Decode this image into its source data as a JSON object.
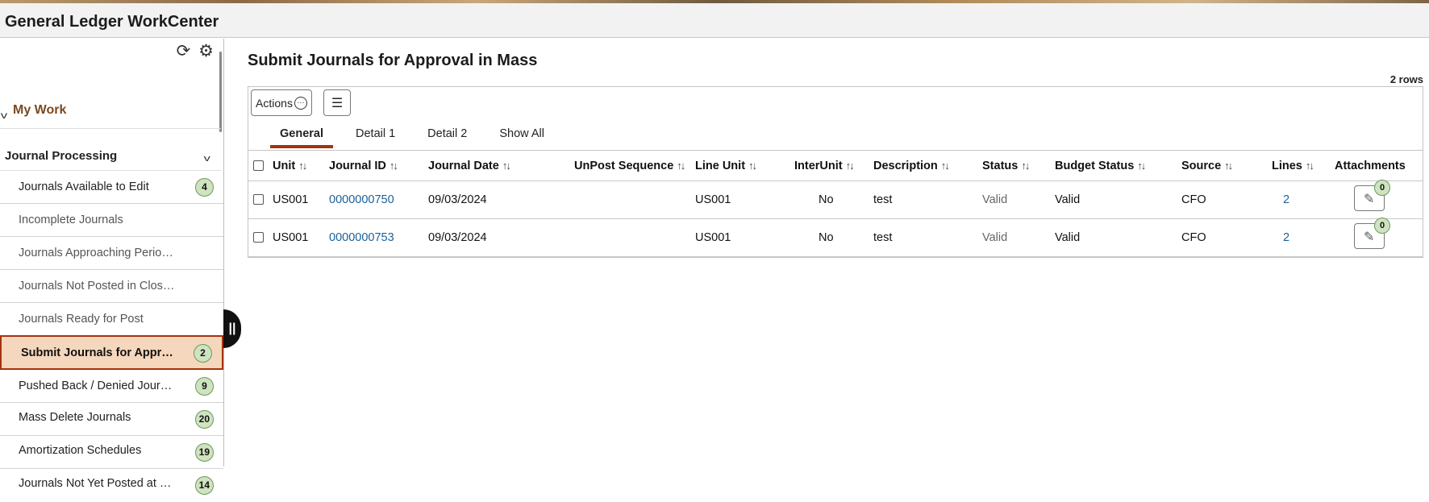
{
  "app": {
    "title": "General Ledger WorkCenter"
  },
  "sidebar": {
    "my_work_label": "My Work",
    "section_label": "Journal Processing",
    "items": [
      {
        "label": "Journals Available to Edit",
        "badge": "4",
        "muted": false
      },
      {
        "label": "Incomplete Journals",
        "badge": "",
        "muted": true
      },
      {
        "label": "Journals Approaching Perio…",
        "badge": "",
        "muted": true
      },
      {
        "label": "Journals Not Posted in Clos…",
        "badge": "",
        "muted": true
      },
      {
        "label": "Journals Ready for Post",
        "badge": "",
        "muted": true
      },
      {
        "label": "Submit Journals for Appr…",
        "badge": "2",
        "muted": false,
        "active": true
      },
      {
        "label": "Pushed Back / Denied Jour…",
        "badge": "9",
        "muted": false
      },
      {
        "label": "Mass Delete Journals",
        "badge": "20",
        "muted": false
      },
      {
        "label": "Amortization Schedules",
        "badge": "19",
        "muted": false
      },
      {
        "label": "Journals Not Yet Posted at …",
        "badge": "14",
        "muted": false
      }
    ]
  },
  "main": {
    "title": "Submit Journals for Approval in Mass",
    "row_count": "2 rows",
    "toolbar": {
      "actions_label": "Actions"
    },
    "tabs": [
      "General",
      "Detail 1",
      "Detail 2",
      "Show All"
    ],
    "columns": [
      "Unit",
      "Journal ID",
      "Journal Date",
      "UnPost Sequence",
      "Line Unit",
      "InterUnit",
      "Description",
      "Status",
      "Budget Status",
      "Source",
      "Lines",
      "Attachments"
    ],
    "rows": [
      {
        "unit": "US001",
        "journal_id": "0000000750",
        "journal_date": "09/03/2024",
        "unpost_seq": "",
        "line_unit": "US001",
        "interunit": "No",
        "description": "test",
        "status": "Valid",
        "budget_status": "Valid",
        "source": "CFO",
        "lines": "2",
        "attachments": "0"
      },
      {
        "unit": "US001",
        "journal_id": "0000000753",
        "journal_date": "09/03/2024",
        "unpost_seq": "",
        "line_unit": "US001",
        "interunit": "No",
        "description": "test",
        "status": "Valid",
        "budget_status": "Valid",
        "source": "CFO",
        "lines": "2",
        "attachments": "0"
      }
    ]
  }
}
